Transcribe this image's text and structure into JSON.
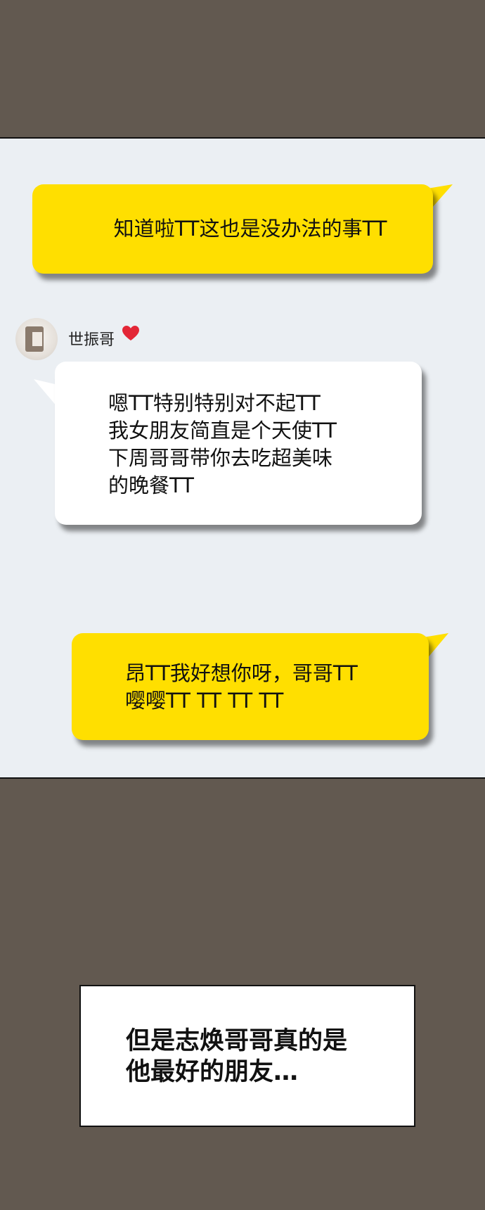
{
  "chat": {
    "messages": [
      {
        "side": "right",
        "color": "#ffdf00",
        "text": "知道啦TT这也是没办法的事TT"
      },
      {
        "side": "left",
        "sender": "世振哥",
        "color": "#ffffff",
        "text": "嗯TT特别特别对不起TT\n我女朋友简直是个天使TT\n下周哥哥带你去吃超美味\n的晚餐TT"
      },
      {
        "side": "right",
        "color": "#ffdf00",
        "text": "昂TT我好想你呀，哥哥TT\n嘤嘤TT TT TT TT"
      }
    ],
    "sender_icons": {
      "avatar": "avatar-photo",
      "heart": "red-heart-icon"
    }
  },
  "narration": {
    "text": "但是志焕哥哥真的是\n他最好的朋友…"
  },
  "colors": {
    "background": "#625950",
    "chat_panel": "#ebeff3",
    "bubble_yellow": "#ffdf00",
    "bubble_white": "#ffffff",
    "heart": "#e32636"
  }
}
